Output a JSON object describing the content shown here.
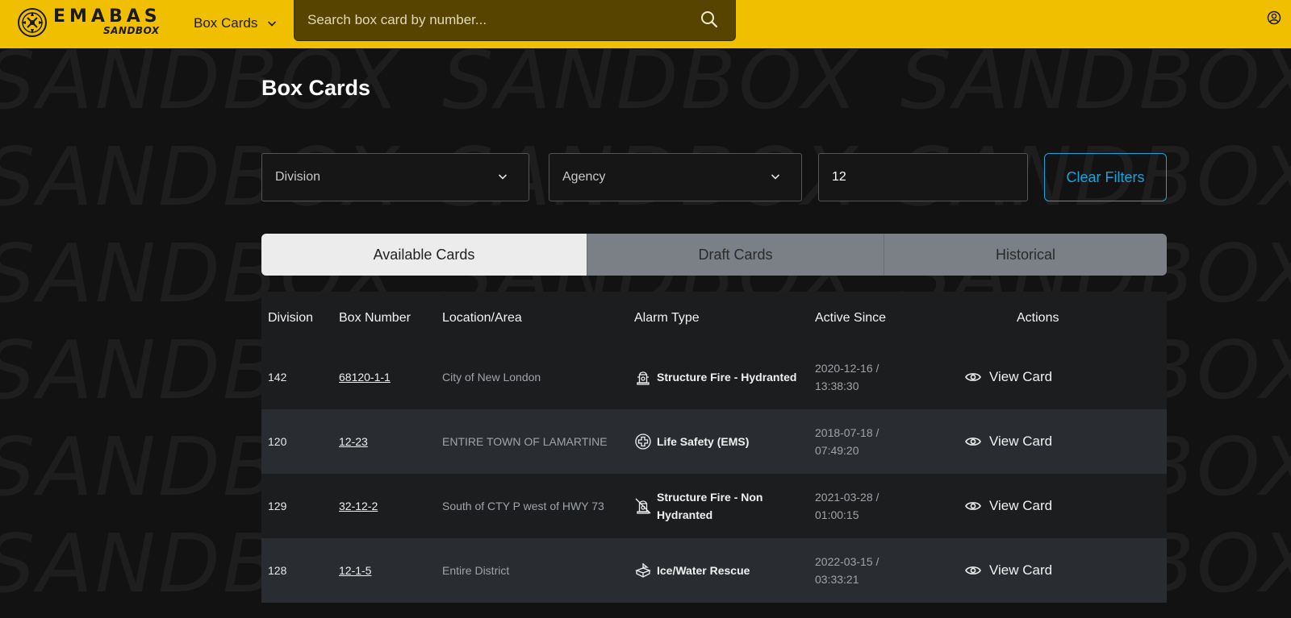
{
  "header": {
    "brand": "EMABAS",
    "brand_sub": "SANDBOX",
    "nav_label": "Box Cards",
    "search_placeholder": "Search box card by number..."
  },
  "watermark": "SANDBOX",
  "page": {
    "title": "Box Cards"
  },
  "filters": {
    "division_label": "Division",
    "agency_label": "Agency",
    "box_value": "12",
    "clear_label": "Clear Filters"
  },
  "tabs": [
    {
      "label": "Available Cards",
      "active": true
    },
    {
      "label": "Draft Cards",
      "active": false
    },
    {
      "label": "Historical",
      "active": false
    }
  ],
  "table": {
    "headers": [
      "Division",
      "Box Number",
      "Location/Area",
      "Alarm Type",
      "Active Since",
      "Actions"
    ],
    "action_label": "View Card",
    "rows": [
      {
        "division": "142",
        "box": "68120-1-1",
        "location": "City of New London",
        "alarm_line1": "Structure Fire - Hydranted",
        "alarm_line2": "",
        "alarm_icon": "hydrant-icon",
        "date": "2020-12-16 /",
        "time": "13:38:30"
      },
      {
        "division": "120",
        "box": "12-23",
        "location": "ENTIRE TOWN OF LAMARTINE",
        "alarm_line1": "Life Safety (EMS)",
        "alarm_line2": "",
        "alarm_icon": "medical-cross-icon",
        "date": "2018-07-18 /",
        "time": "07:49:20"
      },
      {
        "division": "129",
        "box": "32-12-2",
        "location": "South of CTY P west of HWY 73",
        "alarm_line1": "Structure Fire - Non",
        "alarm_line2": "Hydranted",
        "alarm_icon": "no-hydrant-icon",
        "date": "2021-03-28 /",
        "time": "01:00:15"
      },
      {
        "division": "128",
        "box": "12-1-5",
        "location": "Entire District",
        "alarm_line1": "Ice/Water Rescue",
        "alarm_line2": "",
        "alarm_icon": "boat-icon",
        "date": "2022-03-15 /",
        "time": "03:33:21"
      }
    ]
  },
  "colors": {
    "header_bg": "#f0c000",
    "search_bg": "#574400",
    "page_bg": "#121212",
    "accent": "#1aa3d9"
  }
}
